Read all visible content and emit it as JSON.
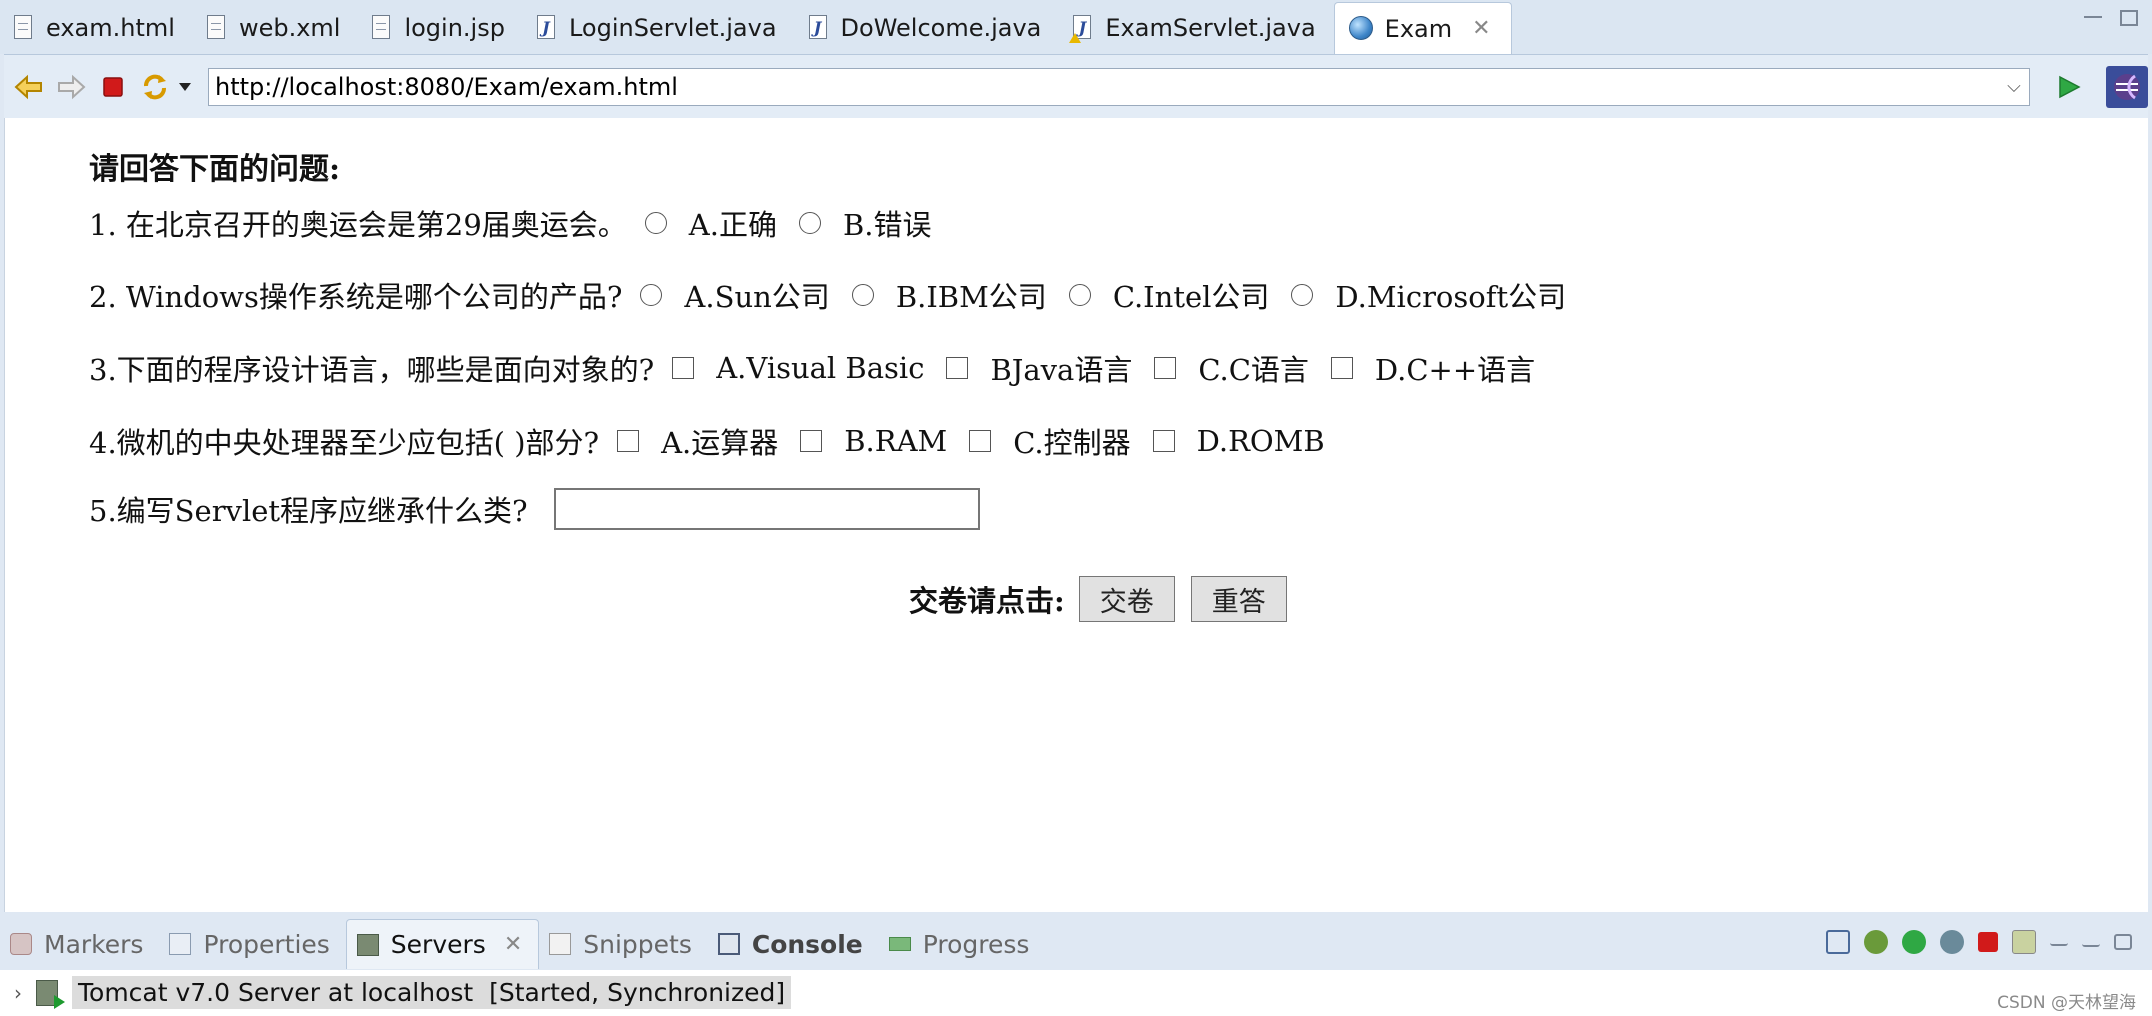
{
  "editor_tabs": [
    {
      "label": "exam.html",
      "icon": "html-file-icon"
    },
    {
      "label": "web.xml",
      "icon": "xml-file-icon"
    },
    {
      "label": "login.jsp",
      "icon": "jsp-file-icon"
    },
    {
      "label": "LoginServlet.java",
      "icon": "java-file-icon"
    },
    {
      "label": "DoWelcome.java",
      "icon": "java-file-icon"
    },
    {
      "label": "ExamServlet.java",
      "icon": "java-file-warning-icon"
    },
    {
      "label": "Exam",
      "icon": "globe-icon",
      "active": true
    }
  ],
  "toolbar": {
    "url": "http://localhost:8080/Exam/exam.html"
  },
  "page": {
    "heading": "请回答下面的问题:",
    "questions": [
      {
        "text": "1.  在北京召开的奥运会是第29届奥运会。",
        "type": "radio",
        "options": [
          "A.正确",
          "B.错误"
        ]
      },
      {
        "text": "2.  Windows操作系统是哪个公司的产品?",
        "type": "radio",
        "options": [
          "A.Sun公司",
          "B.IBM公司",
          "C.Intel公司",
          "D.Microsoft公司"
        ]
      },
      {
        "text": "3.下面的程序设计语言，哪些是面向对象的?",
        "type": "checkbox",
        "options": [
          "A.Visual Basic",
          "BJava语言",
          "C.C语言",
          "D.C++语言"
        ]
      },
      {
        "text": "4.微机的中央处理器至少应包括( )部分?",
        "type": "checkbox",
        "options": [
          "A.运算器",
          "B.RAM",
          "C.控制器",
          "D.ROMB"
        ]
      },
      {
        "text": "5.编写Servlet程序应继承什么类?",
        "type": "text",
        "value": ""
      }
    ],
    "submit_label": "交卷请点击:",
    "submit_button": "交卷",
    "reset_button": "重答"
  },
  "views_tabs": [
    {
      "label": "Markers",
      "icon": "markers-icon"
    },
    {
      "label": "Properties",
      "icon": "properties-icon"
    },
    {
      "label": "Servers",
      "icon": "servers-icon",
      "active": true
    },
    {
      "label": "Snippets",
      "icon": "snippets-icon"
    },
    {
      "label": "Console",
      "icon": "console-icon"
    },
    {
      "label": "Progress",
      "icon": "progress-icon"
    }
  ],
  "servers": {
    "name": "Tomcat v7.0 Server at localhost",
    "status": "[Started, Synchronized]"
  },
  "watermark": "CSDN @天林望海",
  "colors": {
    "accent": "#3a4d9a",
    "run_green": "#1e9a2f",
    "stop_red": "#d11a1a",
    "chrome_bg": "#dfe8f3"
  }
}
